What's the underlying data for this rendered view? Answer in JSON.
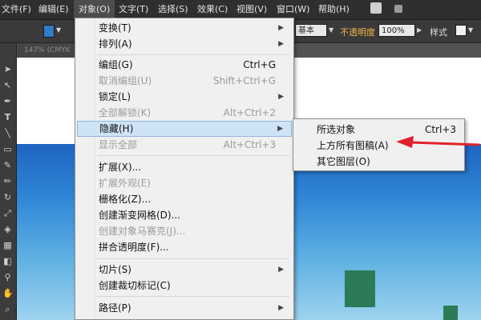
{
  "menubar": {
    "items": [
      "文件(F)",
      "编辑(E)",
      "对象(O)",
      "文字(T)",
      "选择(S)",
      "效果(C)",
      "视图(V)",
      "窗口(W)",
      "帮助(H)"
    ],
    "active_index": 2
  },
  "controlbar": {
    "stroke_style": "基本",
    "opacity_label": "不透明度",
    "opacity_value": "100%",
    "style_label": "样式"
  },
  "document_tab": {
    "label": "147% (CMYK"
  },
  "object_menu": {
    "items": [
      {
        "label": "变换(T)",
        "shortcut": "",
        "submenu": true,
        "disabled": false
      },
      {
        "label": "排列(A)",
        "shortcut": "",
        "submenu": true,
        "disabled": false
      },
      {
        "label": "编组(G)",
        "shortcut": "Ctrl+G",
        "submenu": false,
        "disabled": false
      },
      {
        "label": "取消编组(U)",
        "shortcut": "Shift+Ctrl+G",
        "submenu": false,
        "disabled": true
      },
      {
        "label": "锁定(L)",
        "shortcut": "",
        "submenu": true,
        "disabled": false
      },
      {
        "label": "全部解锁(K)",
        "shortcut": "Alt+Ctrl+2",
        "submenu": false,
        "disabled": true
      },
      {
        "label": "隐藏(H)",
        "shortcut": "",
        "submenu": true,
        "disabled": false,
        "highlighted": true
      },
      {
        "label": "显示全部",
        "shortcut": "Alt+Ctrl+3",
        "submenu": false,
        "disabled": true
      },
      {
        "label": "扩展(X)...",
        "shortcut": "",
        "submenu": false,
        "disabled": false
      },
      {
        "label": "扩展外观(E)",
        "shortcut": "",
        "submenu": false,
        "disabled": true
      },
      {
        "label": "栅格化(Z)...",
        "shortcut": "",
        "submenu": false,
        "disabled": false
      },
      {
        "label": "创建渐变网格(D)...",
        "shortcut": "",
        "submenu": false,
        "disabled": false
      },
      {
        "label": "创建对象马赛克(J)...",
        "shortcut": "",
        "submenu": false,
        "disabled": true
      },
      {
        "label": "拼合透明度(F)...",
        "shortcut": "",
        "submenu": false,
        "disabled": false
      },
      {
        "label": "切片(S)",
        "shortcut": "",
        "submenu": true,
        "disabled": false
      },
      {
        "label": "创建裁切标记(C)",
        "shortcut": "",
        "submenu": false,
        "disabled": false
      },
      {
        "label": "路径(P)",
        "shortcut": "",
        "submenu": true,
        "disabled": false
      }
    ]
  },
  "hide_submenu": {
    "items": [
      {
        "label": "所选对象",
        "shortcut": "Ctrl+3"
      },
      {
        "label": "上方所有图稿(A)",
        "shortcut": ""
      },
      {
        "label": "其它图层(O)",
        "shortcut": ""
      }
    ]
  },
  "colors": {
    "menu_highlight": "#cfe3f6",
    "annotation_arrow": "#e0222a",
    "opacity_label": "#f2b84a"
  }
}
